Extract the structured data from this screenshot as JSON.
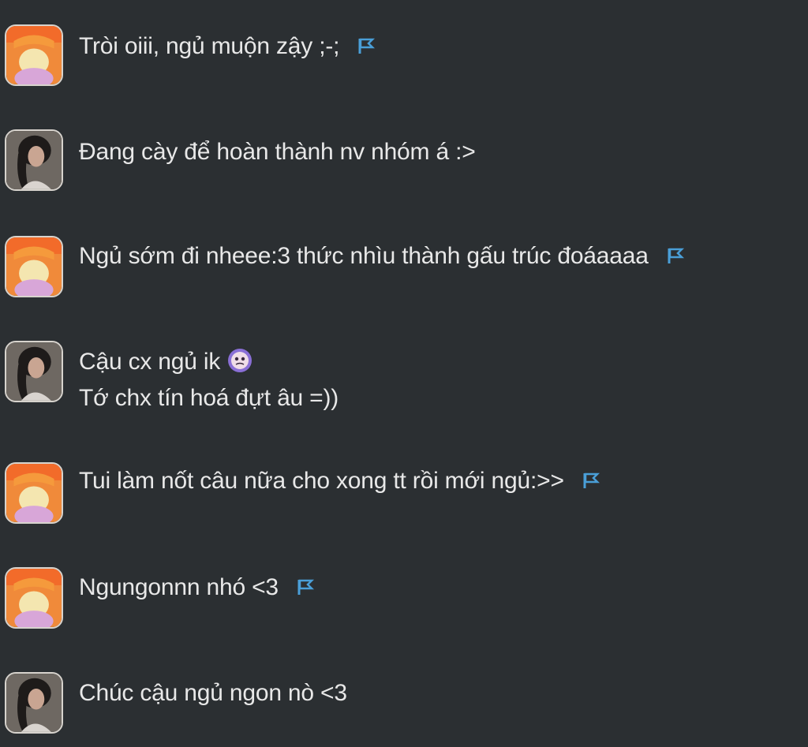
{
  "theme": {
    "background": "#2b2f32",
    "text": "#e8e8e8",
    "flag_color": "#4a9fd8",
    "avatar_border": "#d7d3cd"
  },
  "messages": [
    {
      "sender": "orange-avatar",
      "lines": [
        "Tròi oiii, ngủ muộn zậy ;-;"
      ],
      "flag": true
    },
    {
      "sender": "dark-avatar",
      "lines": [
        "Đang cày để hoàn thành nv nhóm á :>"
      ],
      "flag": false
    },
    {
      "sender": "orange-avatar",
      "lines": [
        "Ngủ sớm đi nheee:3 thức nhìu thành gấu trúc đoáaaaa"
      ],
      "flag": true
    },
    {
      "sender": "dark-avatar",
      "lines": [
        "Cậu cx ngủ ik",
        "Tớ chx tín hoá đựt âu =))"
      ],
      "flag": false,
      "emoji": "pleading-face-icon"
    },
    {
      "sender": "orange-avatar",
      "lines": [
        "Tui làm nốt câu nữa cho xong tt rồi mới ngủ:>>"
      ],
      "flag": true
    },
    {
      "sender": "orange-avatar",
      "lines": [
        "Ngungonnn nhó <3"
      ],
      "flag": true
    },
    {
      "sender": "dark-avatar",
      "lines": [
        "Chúc cậu ngủ ngon nò <3"
      ],
      "flag": false
    }
  ]
}
